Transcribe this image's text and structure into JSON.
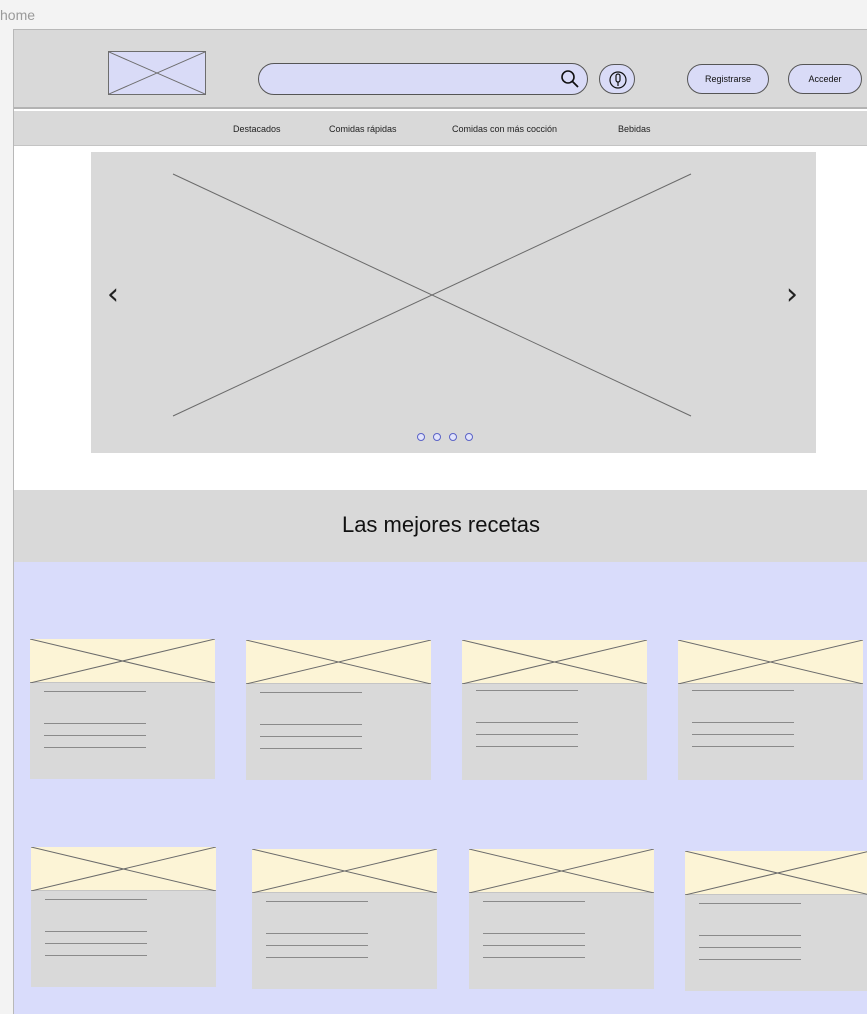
{
  "frame": {
    "label": "home"
  },
  "header": {
    "logo_icon": "image-placeholder-icon",
    "search": {
      "placeholder": "",
      "icon": "search-icon"
    },
    "mic_icon": "microphone-icon",
    "register_label": "Registrarse",
    "login_label": "Acceder"
  },
  "nav": {
    "items": [
      {
        "label": "Destacados"
      },
      {
        "label": "Comidas rápidas"
      },
      {
        "label": "Comidas con más cocción"
      },
      {
        "label": "Bebidas"
      }
    ]
  },
  "carousel": {
    "prev_icon": "chevron-left-icon",
    "next_icon": "chevron-right-icon",
    "prev_glyph": "‹",
    "next_glyph": "›",
    "slide_count": 4
  },
  "section": {
    "title": "Las mejores recetas"
  },
  "recipes": {
    "card_count": 8
  },
  "colors": {
    "header_gray": "#d9d9d9",
    "accent_lavender": "#d9dbf7",
    "grid_background": "#d9dcfb",
    "card_image_fill": "#fcf4d6"
  }
}
